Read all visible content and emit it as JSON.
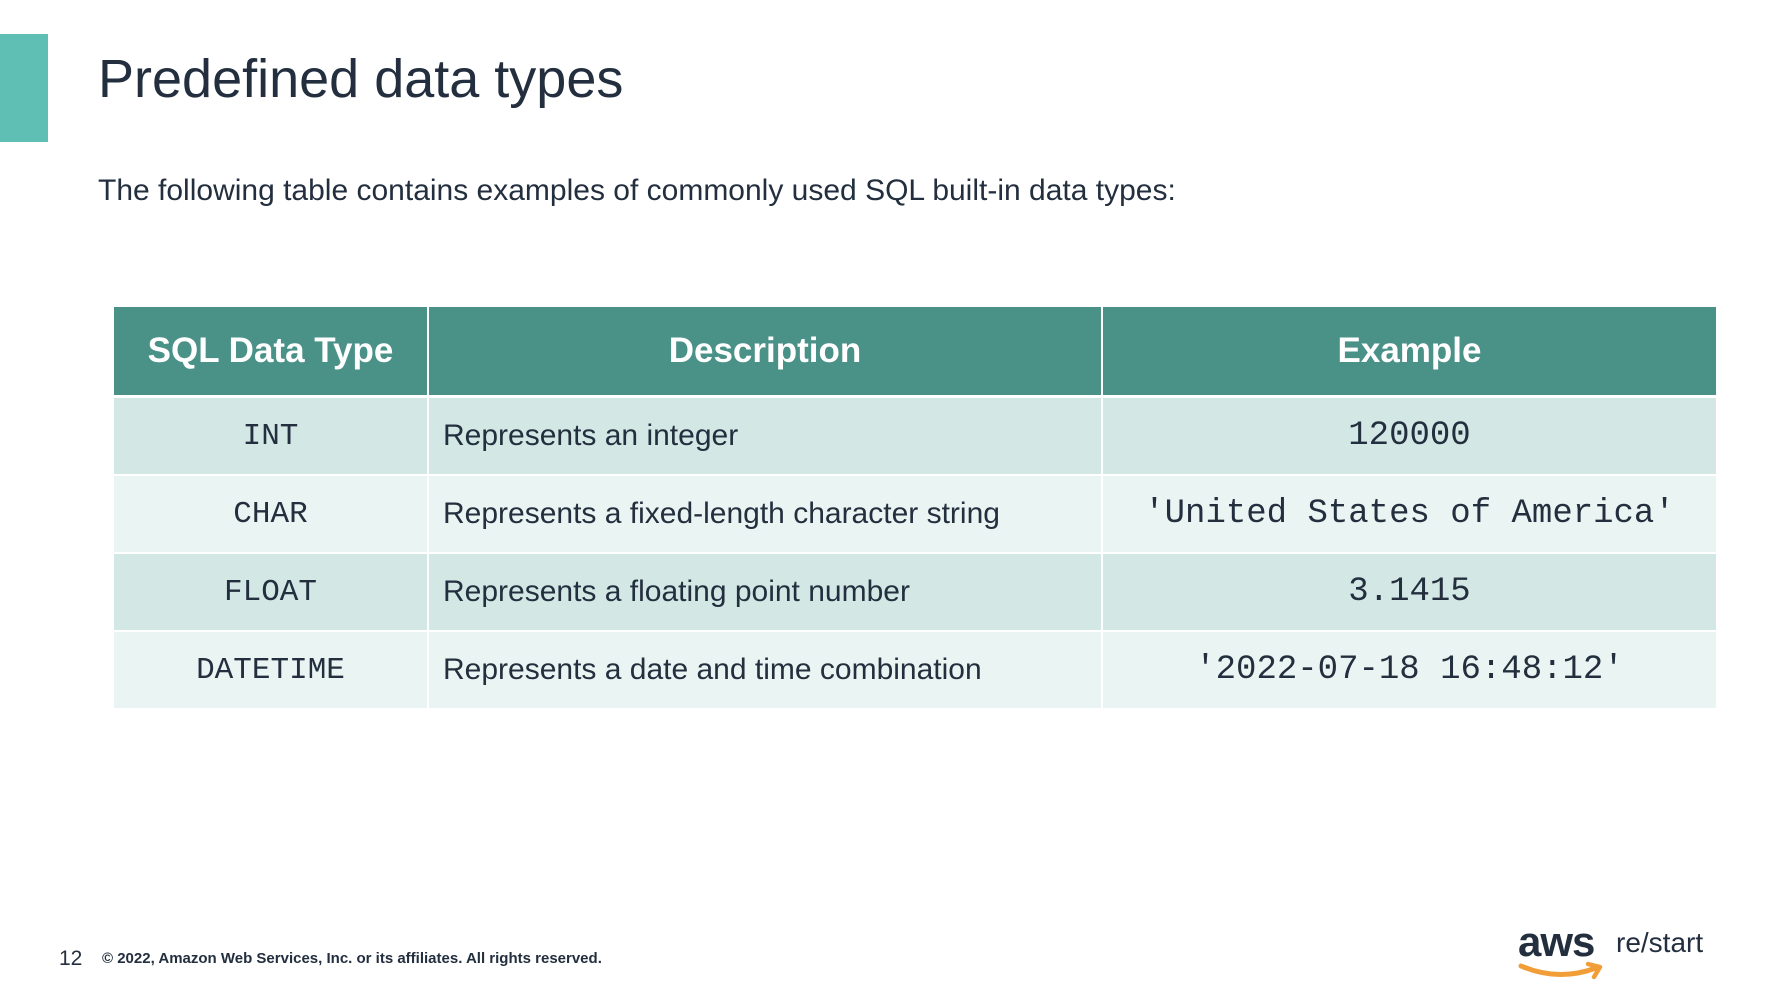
{
  "slide": {
    "title": "Predefined data types",
    "intro": "The following table contains examples of commonly used SQL built-in data types:",
    "accent_color": "#5fbfb4"
  },
  "table": {
    "header_color": "#4a9188",
    "headers": [
      "SQL Data Type",
      "Description",
      "Example"
    ],
    "rows": [
      {
        "type": "INT",
        "description": "Represents an integer",
        "example": "120000"
      },
      {
        "type": "CHAR",
        "description": "Represents a fixed-length character string",
        "example": "'United States of America'"
      },
      {
        "type": "FLOAT",
        "description": "Represents a floating point number",
        "example": "3.1415"
      },
      {
        "type": "DATETIME",
        "description": "Represents a date and time combination",
        "example": "'2022-07-18 16:48:12'"
      }
    ]
  },
  "footer": {
    "page_number": "12",
    "copyright": "© 2022, Amazon Web Services, Inc. or its affiliates. All rights reserved.",
    "logo_aws": "aws",
    "logo_restart": "re/start",
    "logo_smile_color": "#f29e38"
  }
}
